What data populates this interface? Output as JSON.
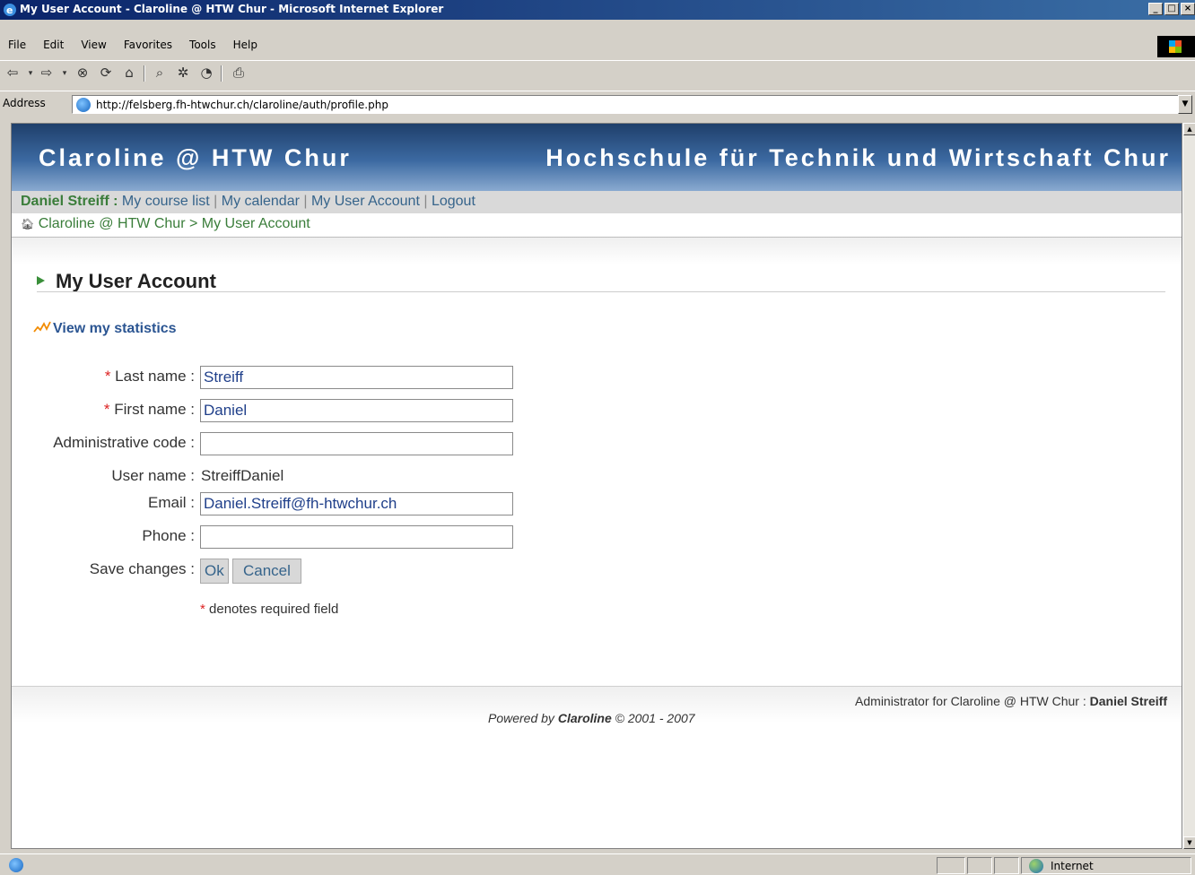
{
  "window": {
    "title": "My User Account - Claroline @ HTW Chur - Microsoft Internet Explorer",
    "buttons": [
      "_",
      "□",
      "×"
    ]
  },
  "menu": [
    "File",
    "Edit",
    "View",
    "Favorites",
    "Tools",
    "Help"
  ],
  "toolbar": {
    "icons": [
      "back-icon",
      "forward-icon",
      "stop-icon",
      "refresh-icon",
      "home-icon",
      "search-icon",
      "favorites-icon",
      "history-icon",
      "print-icon"
    ]
  },
  "address": {
    "label": "Address",
    "url": "http://felsberg.fh-htwchur.ch/claroline/auth/profile.php"
  },
  "banner": {
    "site_name": "Claroline @ HTW Chur",
    "institution": "Hochschule für Technik und Wirtschaft Chur"
  },
  "userbar": {
    "user": "Daniel Streiff :",
    "links": [
      "My course list",
      "My calendar",
      "My User Account",
      "Logout"
    ]
  },
  "breadcrumb": {
    "home": "Claroline @ HTW Chur",
    "separator": ">",
    "current": "My User Account"
  },
  "page": {
    "title": "My User Account",
    "stats_link": "View my statistics"
  },
  "form": {
    "required_mark": "*",
    "last_name": {
      "label": "Last name :",
      "value": "Streiff"
    },
    "first_name": {
      "label": "First name :",
      "value": "Daniel"
    },
    "admin_code": {
      "label": "Administrative code :",
      "value": ""
    },
    "username": {
      "label": "User name :",
      "value": "StreiffDaniel"
    },
    "email": {
      "label": "Email :",
      "value": "Daniel.Streiff@fh-htwchur.ch"
    },
    "phone": {
      "label": "Phone :",
      "value": ""
    },
    "save": {
      "label": "Save changes :",
      "ok": "Ok",
      "cancel": "Cancel"
    },
    "required_note": "denotes required field"
  },
  "footer": {
    "admin_prefix": "Administrator for Claroline @ HTW Chur :",
    "admin_name": "Daniel Streiff",
    "powered_prefix": "Powered by",
    "powered_brand": "Claroline",
    "powered_suffix": "© 2001 - 2007"
  },
  "status": {
    "zone": "Internet"
  }
}
